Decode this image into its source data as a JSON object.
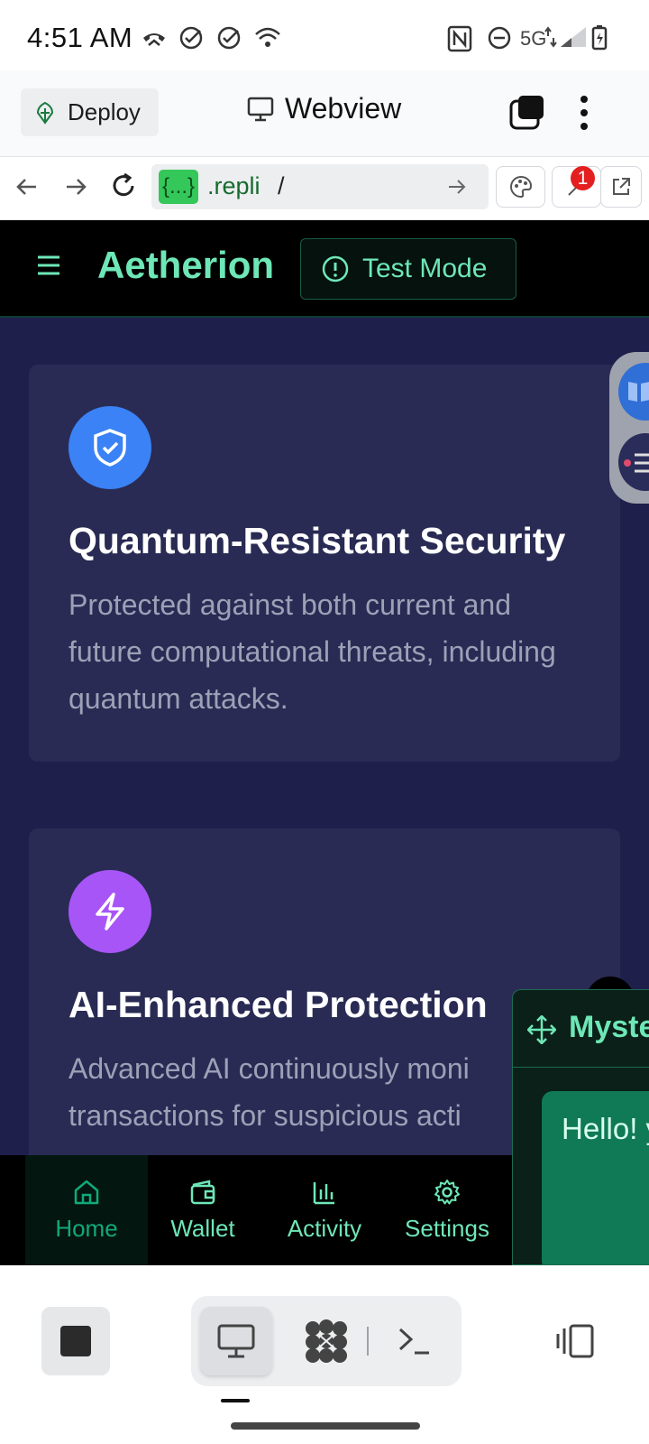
{
  "status_bar": {
    "time": "4:51 AM",
    "network": "5G"
  },
  "replit_bar": {
    "deploy_label": "Deploy",
    "view_title": "Webview",
    "url_badge": "{...}",
    "url_host": ".repli",
    "url_path": "/",
    "notification_count": "1"
  },
  "app_header": {
    "brand": "Aetherion",
    "test_mode_label": "Test Mode"
  },
  "features": [
    {
      "icon": "shield-check-icon",
      "color": "#3b82f6",
      "title": "Quantum-Resistant Security",
      "description": "Protected against both current and future computational threats, including quantum attacks."
    },
    {
      "icon": "lightning-icon",
      "color": "#a855f7",
      "title": "AI-Enhanced Protection",
      "description": "Advanced AI continuously moni transactions for suspicious acti"
    }
  ],
  "bottom_nav": {
    "items": [
      {
        "label": "Home",
        "icon": "home-icon",
        "active": true
      },
      {
        "label": "Wallet",
        "icon": "wallet-icon"
      },
      {
        "label": "Activity",
        "icon": "bar-chart-icon"
      },
      {
        "label": "Settings",
        "icon": "gear-icon"
      }
    ]
  },
  "chat_widget": {
    "title": "Myste",
    "message": "Hello! your A can I h"
  },
  "colors": {
    "accent": "#6ee7b7",
    "background": "#1e1f4b",
    "card": "#292b54"
  }
}
